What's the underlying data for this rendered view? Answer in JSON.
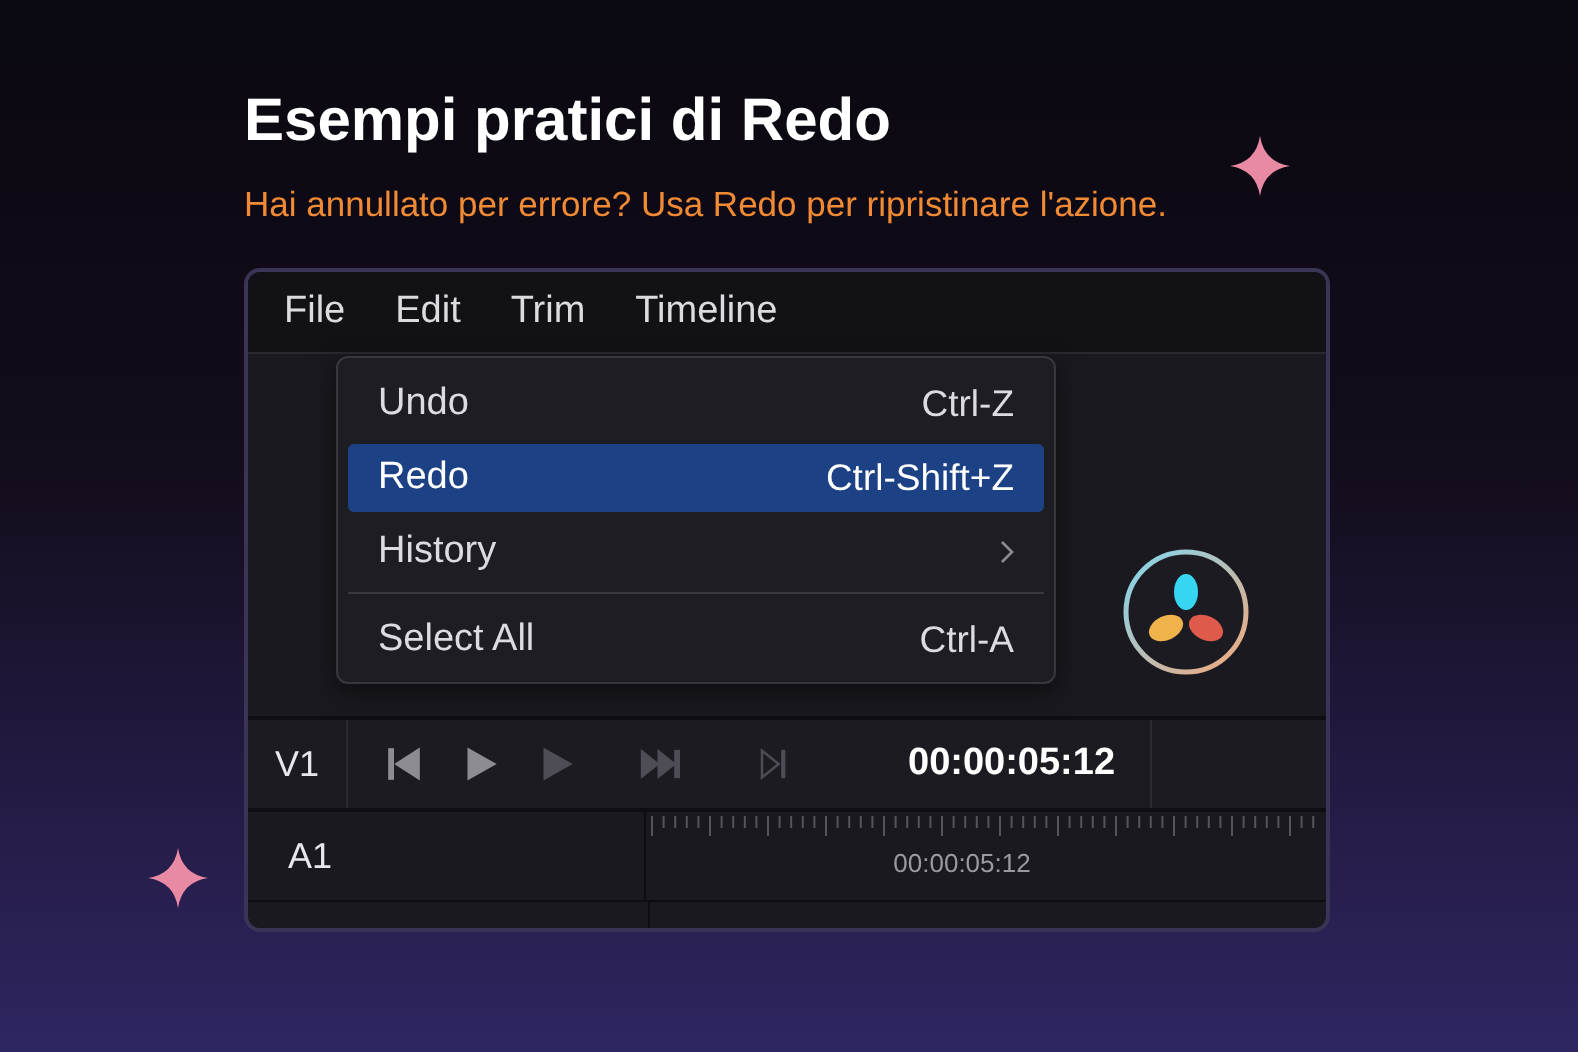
{
  "title": "Esempi pratici di Redo",
  "subtitle": "Hai annullato per errore? Usa Redo per ripristinare l'azione.",
  "menubar": [
    "File",
    "Edit",
    "Trim",
    "Timeline"
  ],
  "menu": [
    {
      "label": "Undo",
      "shortcut": "Ctrl-Z",
      "selected": false,
      "submenu": false,
      "separator_before": false
    },
    {
      "label": "Redo",
      "shortcut": "Ctrl-Shift+Z",
      "selected": true,
      "submenu": false,
      "separator_before": false
    },
    {
      "label": "History",
      "selected": false,
      "submenu": true,
      "separator_before": false
    },
    {
      "label": "Select All",
      "shortcut": "Ctrl-A",
      "selected": false,
      "submenu": false,
      "separator_before": true
    }
  ],
  "transport": {
    "track": "V1",
    "controls": [
      {
        "kind": "skip-back",
        "disabled": false
      },
      {
        "kind": "play",
        "disabled": false
      },
      {
        "kind": "play",
        "disabled": true
      },
      {
        "kind": "fast-forward",
        "disabled": true
      },
      {
        "kind": "step-end",
        "disabled": true
      }
    ],
    "timecode": "00:00:05:12"
  },
  "audio_track": {
    "track": "A1",
    "ruler_timecode": "00:00:05:12"
  }
}
